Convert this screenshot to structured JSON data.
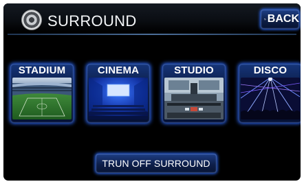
{
  "header": {
    "title": "SURROUND",
    "back_label": "BACK"
  },
  "modes": [
    {
      "label": "STADIUM",
      "image": "stadium-field-photo"
    },
    {
      "label": "CINEMA",
      "image": "cinema-hall-photo"
    },
    {
      "label": "STUDIO",
      "image": "recording-studio-photo"
    },
    {
      "label": "DISCO",
      "image": "disco-lights-photo"
    }
  ],
  "footer": {
    "off_label": "TRUN OFF SURROUND"
  },
  "colors": {
    "accent_glow": "#2f6fff",
    "button_bg": "#0e1f48",
    "screen_bg": "#000000",
    "text": "#ffffff"
  }
}
